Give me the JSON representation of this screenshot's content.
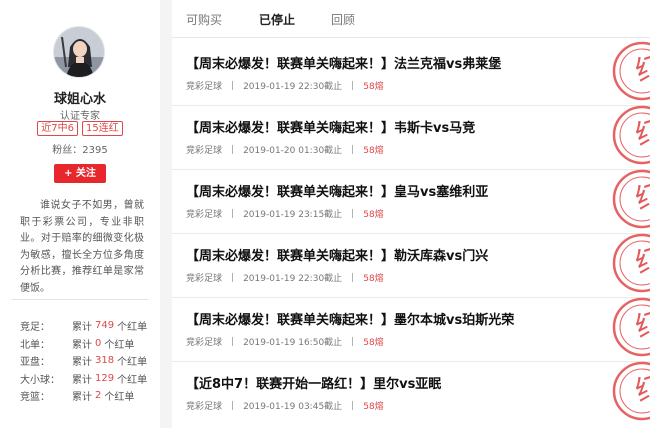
{
  "profile": {
    "nickname": "球姐心水",
    "certification": "认证专家",
    "badges": [
      "近7中6",
      "15连红"
    ],
    "fans_label": "粉丝：",
    "fans_count": "2395",
    "follow_button": "+ 关注",
    "bio": "谁说女子不如男，曾就职于彩票公司，专业非职业。对于赔率的细微变化极为敏感，擅长全方位多角度分析比赛，推荐红单是家常便饭。"
  },
  "stats": [
    {
      "name": "竞足：",
      "prefix": "累计",
      "count": "749",
      "suffix": "个红单"
    },
    {
      "name": "北单：",
      "prefix": "累计",
      "count": "0",
      "suffix": "个红单"
    },
    {
      "name": "亚盘：",
      "prefix": "累计",
      "count": "318",
      "suffix": "个红单"
    },
    {
      "name": "大小球：",
      "prefix": "累计",
      "count": "129",
      "suffix": "个红单"
    },
    {
      "name": "竞篮：",
      "prefix": "累计",
      "count": "2",
      "suffix": "个红单"
    }
  ],
  "tabs": {
    "buyable": "可购买",
    "stopped": "已停止",
    "replay": "回顾",
    "active": "stopped"
  },
  "articles": [
    {
      "title": "【周末必爆发！联赛单关嗨起来！】法兰克福vs弗莱堡",
      "category": "竞彩足球",
      "time": "2019-01-19 22:30截止",
      "price": "58熔",
      "stamp": "红"
    },
    {
      "title": "【周末必爆发！联赛单关嗨起来！】韦斯卡vs马竞",
      "category": "竞彩足球",
      "time": "2019-01-20 01:30截止",
      "price": "58熔",
      "stamp": "红"
    },
    {
      "title": "【周末必爆发！联赛单关嗨起来！】皇马vs塞维利亚",
      "category": "竞彩足球",
      "time": "2019-01-19 23:15截止",
      "price": "58熔",
      "stamp": "红"
    },
    {
      "title": "【周末必爆发！联赛单关嗨起来！】勒沃库森vs门兴",
      "category": "竞彩足球",
      "time": "2019-01-19 22:30截止",
      "price": "58熔",
      "stamp": "红"
    },
    {
      "title": "【周末必爆发！联赛单关嗨起来！】墨尔本城vs珀斯光荣",
      "category": "竞彩足球",
      "time": "2019-01-19 16:50截止",
      "price": "58熔",
      "stamp": "红"
    },
    {
      "title": "【近8中7！联赛开始一路红！】里尔vs亚眠",
      "category": "竞彩足球",
      "time": "2019-01-19 03:45截止",
      "price": "58熔",
      "stamp": "红"
    }
  ],
  "colors": {
    "accent_red": "#e8272d",
    "stamp_red": "#e04848"
  }
}
